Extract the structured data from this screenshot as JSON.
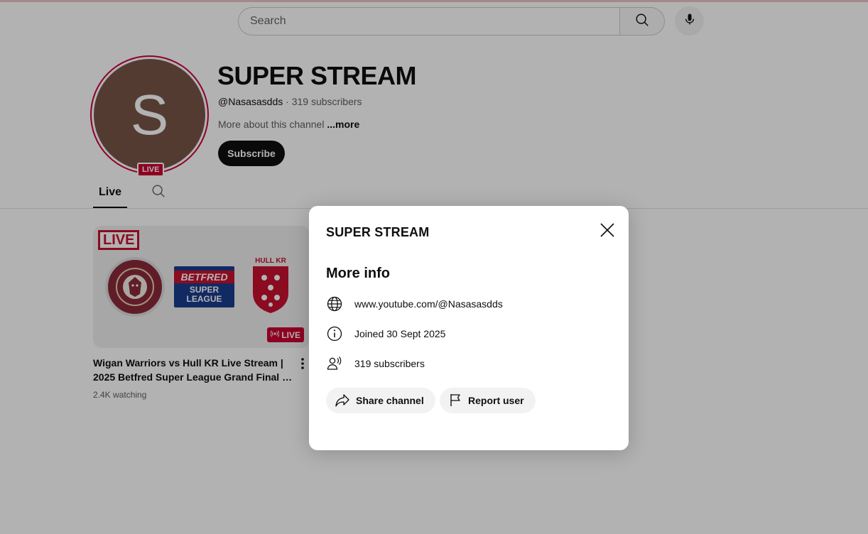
{
  "search": {
    "placeholder": "Search"
  },
  "channel": {
    "avatar_letter": "S",
    "live_badge": "LIVE",
    "title": "SUPER STREAM",
    "handle": "@Nasasasdds",
    "separator": " · ",
    "subscribers": "319 subscribers",
    "about": "More about this channel",
    "about_more": "...more",
    "subscribe_label": "Subscribe"
  },
  "tabs": [
    {
      "label": "Live",
      "selected": true
    }
  ],
  "video": {
    "thumb_live_tag": "LIVE",
    "thumb_live_badge": "LIVE",
    "thumb_betfred": "BETFRED",
    "thumb_super_league": "SUPER LEAGUE",
    "thumb_hullkr": "HULL KR",
    "title_line1": "Wigan Warriors vs Hull KR Live Stream |",
    "title_line2": "2025 Betfred Super League Grand Final Ful...",
    "meta": "2.4K watching"
  },
  "dialog": {
    "title": "SUPER STREAM",
    "section_heading": "More info",
    "url": "www.youtube.com/@Nasasasdds",
    "joined": "Joined 30 Sept 2025",
    "subscribers": "319 subscribers",
    "share_label": "Share channel",
    "report_label": "Report user"
  },
  "colors": {
    "live_red": "#cc0030",
    "avatar_bg": "#795548",
    "avatar_ring": "#cc0040",
    "scrim": "rgba(0,0,0,0.30)"
  },
  "icons": [
    "search-icon",
    "mic-icon",
    "globe-icon",
    "info-icon",
    "people-icon",
    "share-icon",
    "flag-icon",
    "close-icon",
    "more-vert-icon",
    "live-broadcast-icon"
  ]
}
